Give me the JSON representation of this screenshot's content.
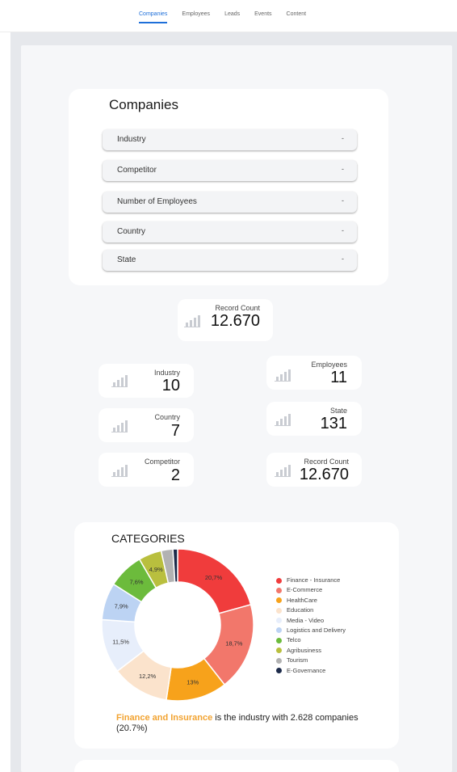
{
  "nav": {
    "tabs": [
      {
        "label": "Companies",
        "active": true
      },
      {
        "label": "Employees",
        "active": false
      },
      {
        "label": "Leads",
        "active": false
      },
      {
        "label": "Events",
        "active": false
      },
      {
        "label": "Content",
        "active": false
      }
    ],
    "accent": "#1e6fd9"
  },
  "filters": {
    "title": "Companies",
    "items": [
      {
        "label": "Industry",
        "caret": "-"
      },
      {
        "label": "Competitor",
        "caret": "-"
      },
      {
        "label": "Number of Employees",
        "caret": "-"
      },
      {
        "label": "Country",
        "caret": "-"
      },
      {
        "label": "State",
        "caret": "-"
      }
    ]
  },
  "stats": {
    "record_main": {
      "label": "Record Count",
      "value": "12.670",
      "icon": "bar-chart-icon"
    },
    "industry": {
      "label": "Industry",
      "value": "10",
      "icon": "bar-chart-icon"
    },
    "employees": {
      "label": "Employees",
      "value": "11",
      "icon": "bar-chart-icon"
    },
    "country": {
      "label": "Country",
      "value": "7",
      "icon": "bar-chart-icon"
    },
    "state": {
      "label": "State",
      "value": "131",
      "icon": "bar-chart-icon"
    },
    "competitor": {
      "label": "Competitor",
      "value": "2",
      "icon": "bar-chart-icon"
    },
    "record_small": {
      "label": "Record Count",
      "value": "12.670",
      "icon": "bar-chart-icon"
    }
  },
  "categories": {
    "title": "CATEGORIES",
    "insight": {
      "highlight": "Finance and Insurance",
      "text": " is the industry with 2.628 companies (20.7%)"
    }
  },
  "chart_data": {
    "type": "pie",
    "donut": true,
    "title": "CATEGORIES",
    "legend_placement": "right",
    "series": [
      {
        "name": "Finance - Insurance",
        "value": 20.7,
        "label": "20,7%",
        "color": "#f03c3c"
      },
      {
        "name": "E-Commerce",
        "value": 18.7,
        "label": "18,7%",
        "color": "#f2776b"
      },
      {
        "name": "HealthCare",
        "value": 13,
        "label": "13%",
        "color": "#f7a21b"
      },
      {
        "name": "Education",
        "value": 12.2,
        "label": "12,2%",
        "color": "#fbe3cc"
      },
      {
        "name": "Media - Video",
        "value": 11.5,
        "label": "11,5%",
        "color": "#e7eefb"
      },
      {
        "name": "Logistics and Delivery",
        "value": 7.9,
        "label": "7,9%",
        "color": "#bcd3f3"
      },
      {
        "name": "Telco",
        "value": 7.6,
        "label": "7,6%",
        "color": "#6cbb3c"
      },
      {
        "name": "Agribusiness",
        "value": 4.9,
        "label": "4,9%",
        "color": "#b9bf3e"
      },
      {
        "name": "Tourism",
        "value": 2.5,
        "label": "",
        "color": "#b2b2b2"
      },
      {
        "name": "E-Governance",
        "value": 1.0,
        "label": "",
        "color": "#1d2b4a"
      }
    ]
  }
}
